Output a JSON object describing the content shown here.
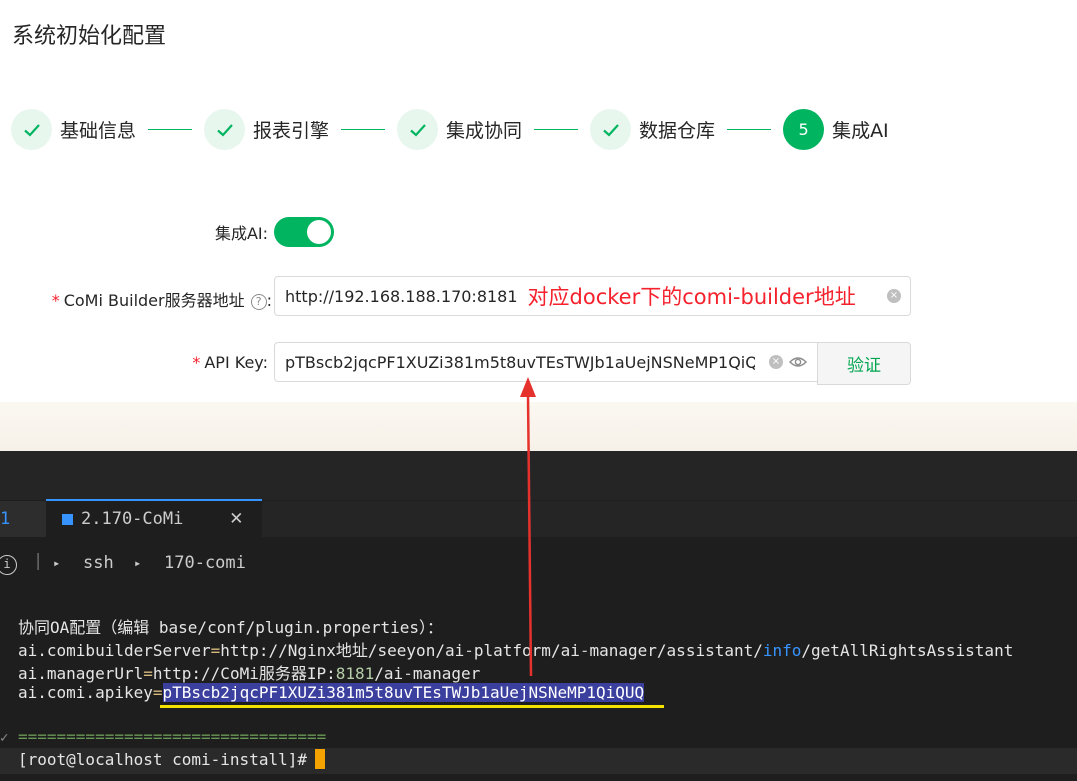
{
  "page": {
    "title": "系统初始化配置"
  },
  "steps": [
    {
      "label": "基础信息",
      "status": "done",
      "marker": "✓"
    },
    {
      "label": "报表引擎",
      "status": "done",
      "marker": "✓"
    },
    {
      "label": "集成协同",
      "status": "done",
      "marker": "✓"
    },
    {
      "label": "数据仓库",
      "status": "done",
      "marker": "✓"
    },
    {
      "label": "集成AI",
      "status": "active",
      "marker": "5"
    }
  ],
  "form": {
    "ai_toggle": {
      "label": "集成AI:",
      "on": true
    },
    "builder_server": {
      "required_mark": "*",
      "label": "CoMi Builder服务器地址",
      "help_icon": "?",
      "colon": ":",
      "value": "http://192.168.188.170:8181",
      "annotation": "对应docker下的comi-builder地址",
      "clear_icon": "×"
    },
    "api_key": {
      "required_mark": "*",
      "label": "API Key:",
      "value": "pTBscb2jqcPF1XUZi381m5t8uvTEsTWJb1aUejNSNeMP1QiQUQ",
      "clear_icon": "×",
      "eye_icon": "eye-icon",
      "verify_label": "验证"
    }
  },
  "terminal": {
    "left_tab_fragment": "1",
    "tab_title": "2.170-CoMi",
    "tab_close": "✕",
    "info_icon": "i",
    "separator": "|",
    "breadcrumb_arrow": "▸",
    "breadcrumb": [
      "ssh",
      "170-comi"
    ],
    "lines": {
      "l1": "协同OA配置（编辑 base/conf/plugin.properties）：",
      "l2_key": "ai.comibuilderServer",
      "l2_eq": "=",
      "l2_a": "http://Nginx地址/seeyon/ai",
      "l2_b": "-",
      "l2_c": "platform/ai",
      "l2_d": "-",
      "l2_e": "manager/assistant/",
      "l2_info": "info",
      "l2_f": "/getAllRightsAssistant",
      "l3_key": "ai.managerUrl",
      "l3_eq": "=",
      "l3_a": "http://CoMi服务器IP:",
      "l3_port": "8181",
      "l3_b": "/ai",
      "l3_dash": "-",
      "l3_c": "manager",
      "l4_key": "ai.comi.apikey",
      "l4_eq": "=",
      "l4_val": "pTBscb2jqcPF1XUZi381m5t8uvTEsTWJb1aUejNSNeMP1QiQUQ",
      "l5": "================================",
      "prompt": "[root@localhost comi-install]#",
      "prompt_tick": "✓"
    }
  },
  "colors": {
    "accent_green": "#00b460",
    "annotation_red": "#f5222d",
    "highlight_blue": "#3b3f9e",
    "underline_yellow": "#f5e400",
    "cursor_orange": "#f5a300"
  }
}
